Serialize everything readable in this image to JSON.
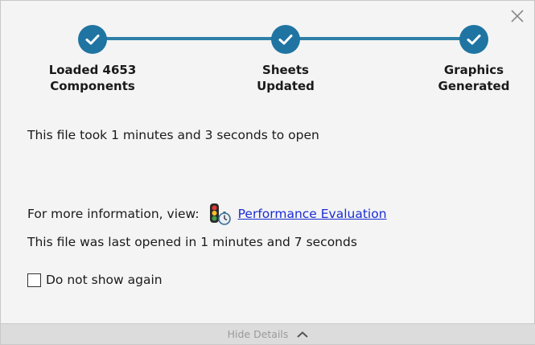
{
  "steps": [
    {
      "label_line1": "Loaded 4653",
      "label_line2": "Components"
    },
    {
      "label_line1": "Sheets",
      "label_line2": "Updated"
    },
    {
      "label_line1": "Graphics",
      "label_line2": "Generated"
    }
  ],
  "colors": {
    "step": "#1f74a2",
    "link": "#1a2cd6"
  },
  "close_symbol": "×",
  "open_time_text": "This file took 1 minutes and 3 seconds to open",
  "more_info_label": "For more information, view:",
  "performance_link": "Performance Evaluation",
  "last_opened_text": "This file was last opened in 1 minutes and 7 seconds",
  "checkbox_label": "Do not show again",
  "footer_label": "Hide Details"
}
